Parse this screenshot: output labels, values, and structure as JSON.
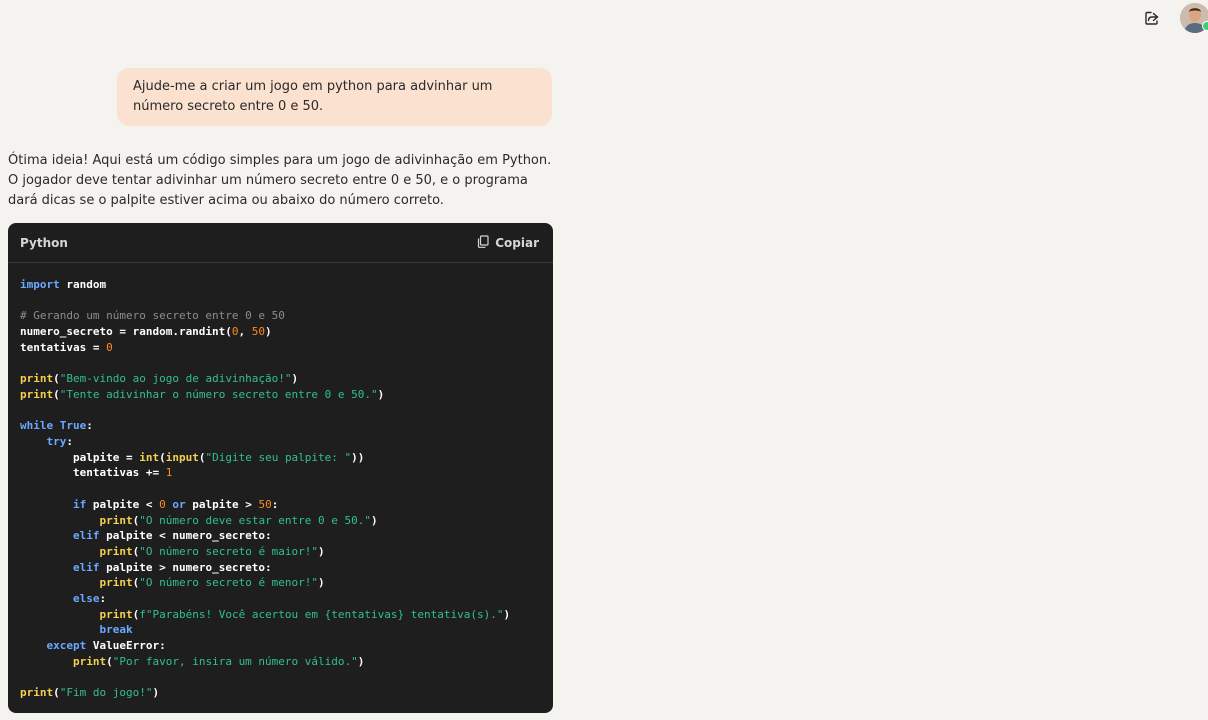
{
  "header": {
    "share_icon": "share-icon",
    "avatar_icon": "user-avatar"
  },
  "conversation": {
    "user_message": "Ajude-me a criar um jogo em python para advinhar um número secreto entre 0 e 50.",
    "assistant_message": "Ótima ideia! Aqui está um código simples para um jogo de adivinhação em Python. O jogador deve tentar adivinhar um número secreto entre 0 e 50, e o programa dará dicas se o palpite estiver acima ou abaixo do número correto."
  },
  "code_block": {
    "language": "Python",
    "copy_label": "Copiar",
    "lines": [
      "import random",
      "",
      "# Gerando um número secreto entre 0 e 50",
      "numero_secreto = random.randint(0, 50)",
      "tentativas = 0",
      "",
      "print(\"Bem-vindo ao jogo de adivinhação!\")",
      "print(\"Tente adivinhar o número secreto entre 0 e 50.\")",
      "",
      "while True:",
      "    try:",
      "        palpite = int(input(\"Digite seu palpite: \"))",
      "        tentativas += 1",
      "",
      "        if palpite < 0 or palpite > 50:",
      "            print(\"O número deve estar entre 0 e 50.\")",
      "        elif palpite < numero_secreto:",
      "            print(\"O número secreto é maior!\")",
      "        elif palpite > numero_secreto:",
      "            print(\"O número secreto é menor!\")",
      "        else:",
      "            print(f\"Parabéns! Você acertou em {tentativas} tentativa(s).\")",
      "            break",
      "    except ValueError:",
      "        print(\"Por favor, insira um número válido.\")",
      "",
      "print(\"Fim do jogo!\")"
    ]
  }
}
